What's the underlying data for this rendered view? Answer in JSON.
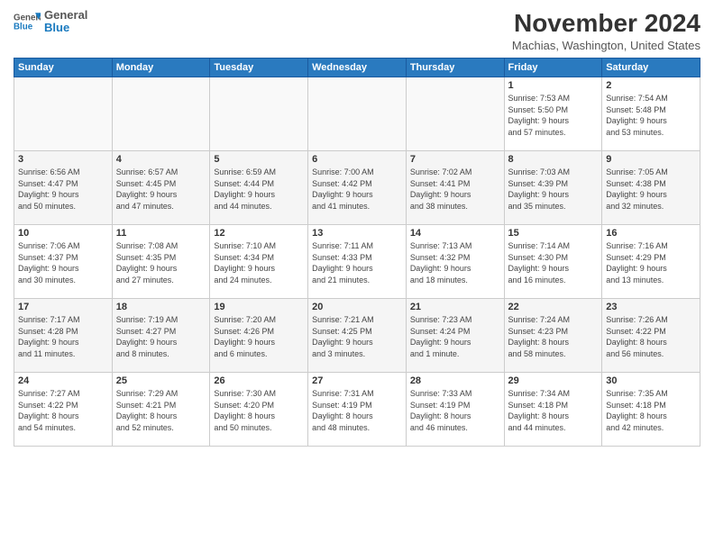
{
  "logo": {
    "line1": "General",
    "line2": "Blue"
  },
  "header": {
    "title": "November 2024",
    "location": "Machias, Washington, United States"
  },
  "days": [
    "Sunday",
    "Monday",
    "Tuesday",
    "Wednesday",
    "Thursday",
    "Friday",
    "Saturday"
  ],
  "weeks": [
    [
      {
        "day": "",
        "info": ""
      },
      {
        "day": "",
        "info": ""
      },
      {
        "day": "",
        "info": ""
      },
      {
        "day": "",
        "info": ""
      },
      {
        "day": "",
        "info": ""
      },
      {
        "day": "1",
        "info": "Sunrise: 7:53 AM\nSunset: 5:50 PM\nDaylight: 9 hours\nand 57 minutes."
      },
      {
        "day": "2",
        "info": "Sunrise: 7:54 AM\nSunset: 5:48 PM\nDaylight: 9 hours\nand 53 minutes."
      }
    ],
    [
      {
        "day": "3",
        "info": "Sunrise: 6:56 AM\nSunset: 4:47 PM\nDaylight: 9 hours\nand 50 minutes."
      },
      {
        "day": "4",
        "info": "Sunrise: 6:57 AM\nSunset: 4:45 PM\nDaylight: 9 hours\nand 47 minutes."
      },
      {
        "day": "5",
        "info": "Sunrise: 6:59 AM\nSunset: 4:44 PM\nDaylight: 9 hours\nand 44 minutes."
      },
      {
        "day": "6",
        "info": "Sunrise: 7:00 AM\nSunset: 4:42 PM\nDaylight: 9 hours\nand 41 minutes."
      },
      {
        "day": "7",
        "info": "Sunrise: 7:02 AM\nSunset: 4:41 PM\nDaylight: 9 hours\nand 38 minutes."
      },
      {
        "day": "8",
        "info": "Sunrise: 7:03 AM\nSunset: 4:39 PM\nDaylight: 9 hours\nand 35 minutes."
      },
      {
        "day": "9",
        "info": "Sunrise: 7:05 AM\nSunset: 4:38 PM\nDaylight: 9 hours\nand 32 minutes."
      }
    ],
    [
      {
        "day": "10",
        "info": "Sunrise: 7:06 AM\nSunset: 4:37 PM\nDaylight: 9 hours\nand 30 minutes."
      },
      {
        "day": "11",
        "info": "Sunrise: 7:08 AM\nSunset: 4:35 PM\nDaylight: 9 hours\nand 27 minutes."
      },
      {
        "day": "12",
        "info": "Sunrise: 7:10 AM\nSunset: 4:34 PM\nDaylight: 9 hours\nand 24 minutes."
      },
      {
        "day": "13",
        "info": "Sunrise: 7:11 AM\nSunset: 4:33 PM\nDaylight: 9 hours\nand 21 minutes."
      },
      {
        "day": "14",
        "info": "Sunrise: 7:13 AM\nSunset: 4:32 PM\nDaylight: 9 hours\nand 18 minutes."
      },
      {
        "day": "15",
        "info": "Sunrise: 7:14 AM\nSunset: 4:30 PM\nDaylight: 9 hours\nand 16 minutes."
      },
      {
        "day": "16",
        "info": "Sunrise: 7:16 AM\nSunset: 4:29 PM\nDaylight: 9 hours\nand 13 minutes."
      }
    ],
    [
      {
        "day": "17",
        "info": "Sunrise: 7:17 AM\nSunset: 4:28 PM\nDaylight: 9 hours\nand 11 minutes."
      },
      {
        "day": "18",
        "info": "Sunrise: 7:19 AM\nSunset: 4:27 PM\nDaylight: 9 hours\nand 8 minutes."
      },
      {
        "day": "19",
        "info": "Sunrise: 7:20 AM\nSunset: 4:26 PM\nDaylight: 9 hours\nand 6 minutes."
      },
      {
        "day": "20",
        "info": "Sunrise: 7:21 AM\nSunset: 4:25 PM\nDaylight: 9 hours\nand 3 minutes."
      },
      {
        "day": "21",
        "info": "Sunrise: 7:23 AM\nSunset: 4:24 PM\nDaylight: 9 hours\nand 1 minute."
      },
      {
        "day": "22",
        "info": "Sunrise: 7:24 AM\nSunset: 4:23 PM\nDaylight: 8 hours\nand 58 minutes."
      },
      {
        "day": "23",
        "info": "Sunrise: 7:26 AM\nSunset: 4:22 PM\nDaylight: 8 hours\nand 56 minutes."
      }
    ],
    [
      {
        "day": "24",
        "info": "Sunrise: 7:27 AM\nSunset: 4:22 PM\nDaylight: 8 hours\nand 54 minutes."
      },
      {
        "day": "25",
        "info": "Sunrise: 7:29 AM\nSunset: 4:21 PM\nDaylight: 8 hours\nand 52 minutes."
      },
      {
        "day": "26",
        "info": "Sunrise: 7:30 AM\nSunset: 4:20 PM\nDaylight: 8 hours\nand 50 minutes."
      },
      {
        "day": "27",
        "info": "Sunrise: 7:31 AM\nSunset: 4:19 PM\nDaylight: 8 hours\nand 48 minutes."
      },
      {
        "day": "28",
        "info": "Sunrise: 7:33 AM\nSunset: 4:19 PM\nDaylight: 8 hours\nand 46 minutes."
      },
      {
        "day": "29",
        "info": "Sunrise: 7:34 AM\nSunset: 4:18 PM\nDaylight: 8 hours\nand 44 minutes."
      },
      {
        "day": "30",
        "info": "Sunrise: 7:35 AM\nSunset: 4:18 PM\nDaylight: 8 hours\nand 42 minutes."
      }
    ]
  ]
}
